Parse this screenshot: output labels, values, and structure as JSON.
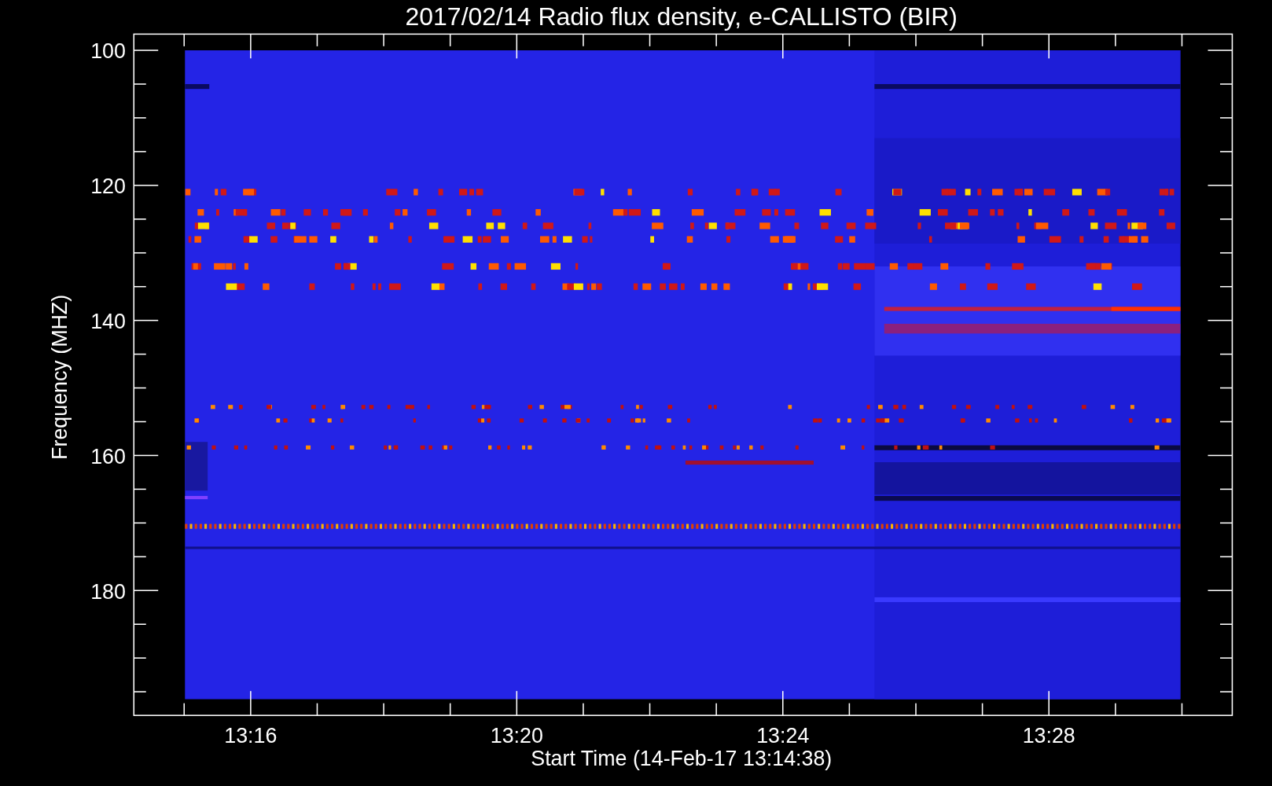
{
  "plot": {
    "title": "2017/02/14  Radio flux density, e-CALLISTO (BIR)",
    "xlabel": "Start Time (14-Feb-17 13:14:38)",
    "ylabel": "Frequency (MHZ)",
    "yticks": [
      "100",
      "120",
      "140",
      "160",
      "180"
    ],
    "xticks": [
      "13:16",
      "13:20",
      "13:24",
      "13:28"
    ]
  }
}
